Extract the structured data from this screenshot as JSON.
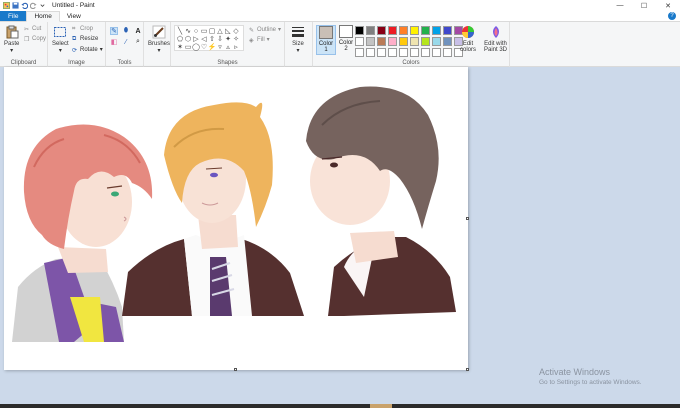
{
  "window": {
    "title": "Untitled - Paint",
    "min": "—",
    "max": "☐",
    "close": "✕"
  },
  "tabs": {
    "file": "File",
    "home": "Home",
    "view": "View",
    "help": "?"
  },
  "clipboard": {
    "paste": "Paste",
    "cut": "Cut",
    "copy": "Copy",
    "label": "Clipboard"
  },
  "image": {
    "select": "Select",
    "crop": "Crop",
    "resize": "Resize",
    "rotate": "Rotate",
    "label": "Image"
  },
  "tools": {
    "label": "Tools",
    "items": [
      "✎",
      "⬮",
      "A",
      "◧",
      "⁄",
      "⌕"
    ]
  },
  "brushes": {
    "label": "Brushes"
  },
  "shapes": {
    "label": "Shapes",
    "outline": "Outline",
    "fill": "Fill",
    "items": [
      "╲",
      "∿",
      "○",
      "▭",
      "▢",
      "△",
      "◺",
      "◇",
      "⬠",
      "⬡",
      "▷",
      "◁",
      "⇧",
      "⇩",
      "✦",
      "✧",
      "✶",
      "▭",
      "◯",
      "♡",
      "⚡",
      "▿",
      "▵",
      "▹"
    ]
  },
  "size": {
    "label": "Size"
  },
  "colors": {
    "color1_label": "Color\n1",
    "color1_line1": "Color",
    "color1_line2": "1",
    "color2_line1": "Color",
    "color2_line2": "2",
    "color1_value": "#c9bfb6",
    "color2_value": "#ffffff",
    "edit_line1": "Edit",
    "edit_line2": "colors",
    "paint3d_line1": "Edit with",
    "paint3d_line2": "Paint 3D",
    "label": "Colors",
    "palette": [
      "#000000",
      "#7f7f7f",
      "#880015",
      "#ed1c24",
      "#ff7f27",
      "#fff200",
      "#22b14c",
      "#00a2e8",
      "#3f48cc",
      "#a349a4",
      "#ffffff",
      "#c3c3c3",
      "#b97a57",
      "#ffaec9",
      "#ffc90e",
      "#efe4b0",
      "#b5e61d",
      "#99d9ea",
      "#7092be",
      "#c8bfe7",
      "#ffffff",
      "#ffffff",
      "#ffffff",
      "#ffffff",
      "#ffffff",
      "#ffffff",
      "#ffffff",
      "#ffffff",
      "#ffffff",
      "#ffffff"
    ]
  },
  "watermark": {
    "line1": "Activate Windows",
    "line2": "Go to Settings to activate Windows."
  }
}
